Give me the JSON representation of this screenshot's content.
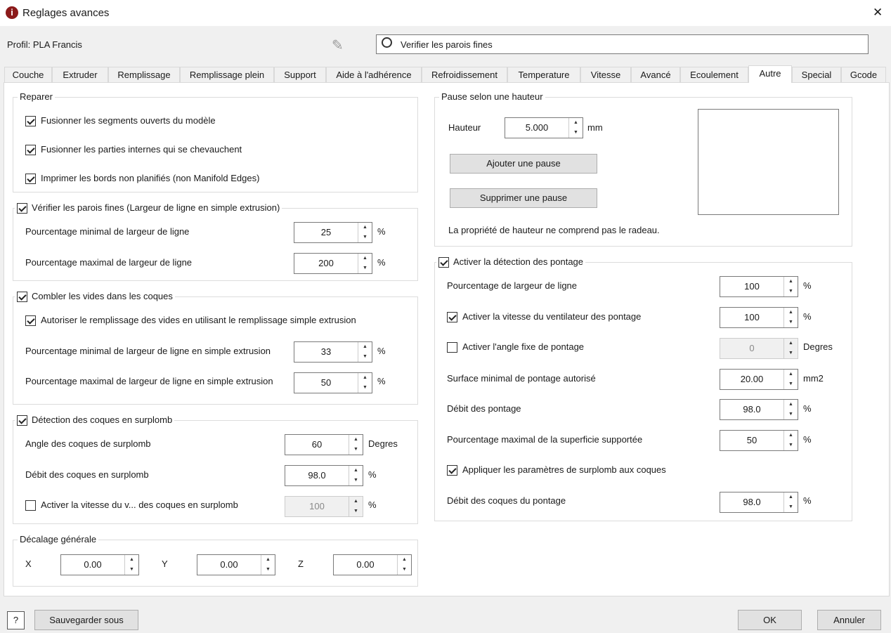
{
  "window": {
    "title": "Reglages avances",
    "close": "✕"
  },
  "toolbar": {
    "profile": "Profil: PLA Francis",
    "search_value": "Verifier les parois fines"
  },
  "tabs": [
    "Couche",
    "Extruder",
    "Remplissage",
    "Remplissage plein",
    "Support",
    "Aide à l'adhérence",
    "Refroidissement",
    "Temperature",
    "Vitesse",
    "Avancé",
    "Ecoulement",
    "Autre",
    "Special",
    "Gcode"
  ],
  "active_tab": "Autre",
  "reparer": {
    "title": "Reparer",
    "items": [
      {
        "label": "Fusionner les segments ouverts du modèle",
        "checked": true
      },
      {
        "label": "Fusionner les parties internes qui se chevauchent",
        "checked": true
      },
      {
        "label": "Imprimer les bords non planifiés (non Manifold Edges)",
        "checked": true
      }
    ]
  },
  "parois": {
    "title": "Vérifier les parois fines (Largeur de ligne en simple extrusion)",
    "checked": true,
    "min_label": "Pourcentage minimal de largeur de ligne",
    "min_value": "25",
    "max_label": "Pourcentage maximal de largeur de ligne",
    "max_value": "200",
    "unit": "%"
  },
  "combler": {
    "title": "Combler les vides dans les coques",
    "checked": true,
    "auto_label": "Autoriser le remplissage des vides en utilisant le remplissage simple extrusion",
    "auto_checked": true,
    "min_label": "Pourcentage minimal de largeur de ligne en simple extrusion",
    "min_value": "33",
    "max_label": "Pourcentage maximal de largeur de ligne en simple extrusion",
    "max_value": "50",
    "unit": "%"
  },
  "surplomb": {
    "title": "Détection des coques en surplomb",
    "checked": true,
    "angle_label": "Angle des coques de surplomb",
    "angle_value": "60",
    "angle_unit": "Degres",
    "debit_label": "Débit des coques en surplomb",
    "debit_value": "98.0",
    "debit_unit": "%",
    "fan_label": "Activer la vitesse du v... des coques en surplomb",
    "fan_checked": false,
    "fan_value": "100",
    "fan_unit": "%"
  },
  "decalage": {
    "title": "Décalage générale",
    "x_label": "X",
    "x": "0.00",
    "y_label": "Y",
    "y": "0.00",
    "z_label": "Z",
    "z": "0.00"
  },
  "pause": {
    "title": "Pause selon une hauteur",
    "hauteur_label": "Hauteur",
    "hauteur": "5.000",
    "unit": "mm",
    "add": "Ajouter une pause",
    "remove": "Supprimer une pause",
    "note": "La propriété de hauteur ne comprend pas le radeau."
  },
  "pontage": {
    "title": "Activer la détection des pontage",
    "checked": true,
    "largeur_label": "Pourcentage de largeur de ligne",
    "largeur": "100",
    "largeur_unit": "%",
    "fan_label": "Activer la vitesse du ventilateur des pontage",
    "fan_checked": true,
    "fan": "100",
    "fan_unit": "%",
    "angle_label": "Activer l'angle fixe de pontage",
    "angle_checked": false,
    "angle": "0",
    "angle_unit": "Degres",
    "surface_label": "Surface minimal de pontage autorisé",
    "surface": "20.00",
    "surface_unit": "mm2",
    "debit_label": "Débit des pontage",
    "debit": "98.0",
    "debit_unit": "%",
    "superficie_label": "Pourcentage maximal de la superficie supportée",
    "superficie": "50",
    "superficie_unit": "%",
    "appliquer_label": "Appliquer les paramètres de surplomb aux coques",
    "appliquer_checked": true,
    "coques_label": "Débit des coques du pontage",
    "coques": "98.0",
    "coques_unit": "%"
  },
  "footer": {
    "help": "?",
    "save_as": "Sauvegarder sous",
    "ok": "OK",
    "cancel": "Annuler"
  }
}
